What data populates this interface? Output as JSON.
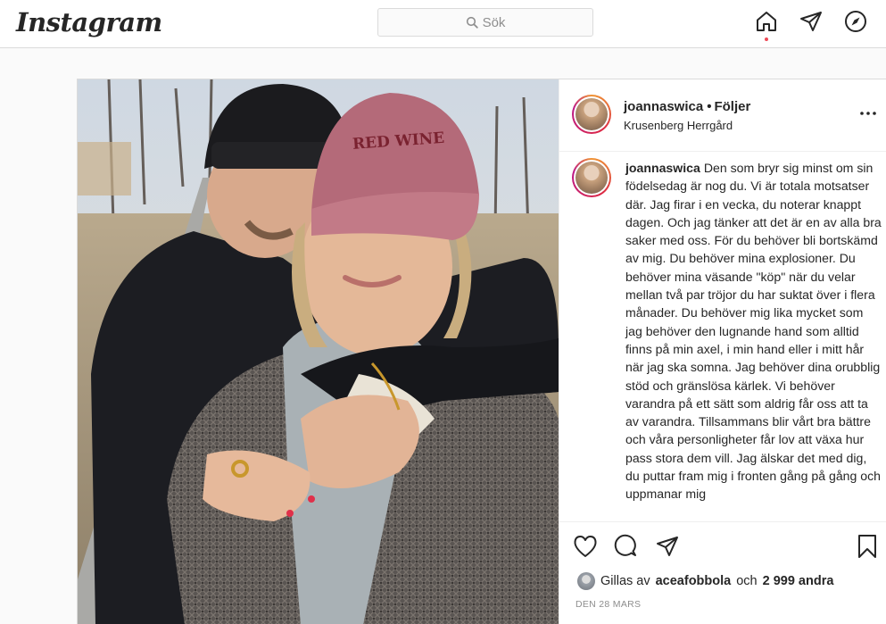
{
  "nav": {
    "logo": "Instagram",
    "search_placeholder": "Sök",
    "icons": [
      "home-icon",
      "direct-icon",
      "explore-icon"
    ]
  },
  "post": {
    "username": "joannaswica",
    "follow_label": "Följer",
    "dot": "•",
    "location": "Krusenberg Herrgård",
    "caption_user": "joannaswica",
    "caption_text": "Den som bryr sig minst om sin födelsedag är nog du. Vi är totala motsatser där. Jag firar i en vecka, du noterar knappt dagen. Och jag tänker att det är en av alla bra saker med oss. För du behöver bli bortskämd av mig. Du behöver mina explosioner. Du behöver mina väsande \"köp\" när du velar mellan två par tröjor du har suktat över i flera månader. Du behöver mig lika mycket som jag behöver den lugnande hand som alltid finns på min axel, i min hand eller i mitt hår när jag ska somna. Jag behöver dina orubblig stöd och gränslösa kärlek. Vi behöver varandra på ett sätt som aldrig får oss att ta av varandra. Tillsammans blir vårt bra bättre och våra personligheter får lov att växa hur pass stora dem vill. Jag älskar det med dig, du puttar fram mig i fronten gång på gång och uppmanar mig",
    "likes_prefix": "Gillas av",
    "likes_user": "aceafobbola",
    "likes_and": "och",
    "likes_count": "2 999 andra",
    "date": "DEN 28 MARS"
  },
  "photo": {
    "cap_text": "RED WINE"
  },
  "colors": {
    "accent_dot": "#ed4956",
    "border": "#dbdbdb",
    "meta_text": "#8e8e8e"
  }
}
